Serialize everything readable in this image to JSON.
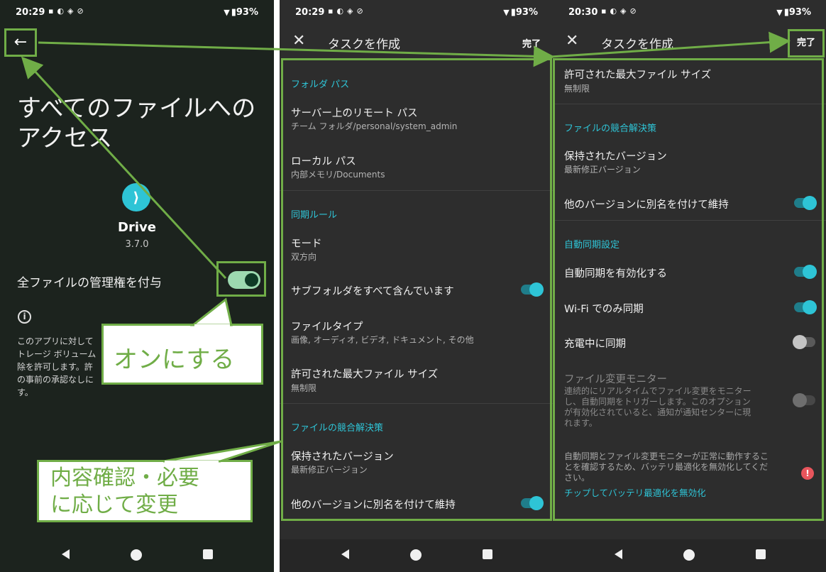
{
  "colors": {
    "accent": "#2ec4d6",
    "annotation": "#70ad47",
    "warning": "#e8555c"
  },
  "panel1": {
    "status": {
      "time": "20:29",
      "battery": "93%"
    },
    "title": "すべてのファイルへのアクセス",
    "app_name": "Drive",
    "app_version": "3.7.0",
    "toggle_label": "全ファイルの管理権を付与",
    "toggle_on": true,
    "description_lines": [
      "このアプリに対して",
      "トレージ ボリューム",
      "除を許可します。許",
      "の事前の承認なしに",
      "す。"
    ]
  },
  "panel2": {
    "status": {
      "time": "20:29",
      "battery": "93%"
    },
    "title": "タスクを作成",
    "done": "完了",
    "sec_folder": "フォルダ パス",
    "remote_title": "サーバー上のリモート パス",
    "remote_value": "チーム フォルダ/personal/system_admin",
    "local_title": "ローカル パス",
    "local_value": "内部メモリ/Documents",
    "sec_sync": "同期ルール",
    "mode_title": "モード",
    "mode_value": "双方向",
    "subfolder_title": "サブフォルダをすべて含んでいます",
    "subfolder_on": true,
    "filetype_title": "ファイルタイプ",
    "filetype_value": "画像, オーディオ, ビデオ, ドキュメント, その他",
    "maxsize_title": "許可された最大ファイル サイズ",
    "maxsize_value": "無制限",
    "sec_conflict": "ファイルの競合解決策",
    "kept_title": "保持されたバージョン",
    "kept_value": "最新修正バージョン",
    "rename_title": "他のバージョンに別名を付けて維持",
    "rename_on": true
  },
  "panel3": {
    "status": {
      "time": "20:30",
      "battery": "93%"
    },
    "title": "タスクを作成",
    "done": "完了",
    "maxsize_title": "許可された最大ファイル サイズ",
    "maxsize_value": "無制限",
    "sec_conflict": "ファイルの競合解決策",
    "kept_title": "保持されたバージョン",
    "kept_value": "最新修正バージョン",
    "rename_title": "他のバージョンに別名を付けて維持",
    "rename_on": true,
    "sec_auto": "自動同期設定",
    "auto_enable_title": "自動同期を有効化する",
    "auto_enable_on": true,
    "wifi_title": "Wi-Fi でのみ同期",
    "wifi_on": true,
    "charging_title": "充電中に同期",
    "charging_on": false,
    "monitor_title": "ファイル変更モニター",
    "monitor_desc_lines": [
      "連続的にリアルタイムでファイル変更をモニター",
      "し、自動同期をトリガーします。このオプション",
      "が有効化されていると、通知が通知センターに現",
      "れます。"
    ],
    "monitor_on": false,
    "battery_note_lines": [
      "自動同期とファイル変更モニターが正常に動作するこ",
      "とを確認するため、バッテリ最適化を無効化してくだ",
      "さい。"
    ],
    "battery_link": "チップしてバッテリ最適化を無効化"
  },
  "callouts": {
    "turn_on": "オンにする",
    "check_line1": "内容確認・必要",
    "check_line2": "に応じて変更"
  }
}
